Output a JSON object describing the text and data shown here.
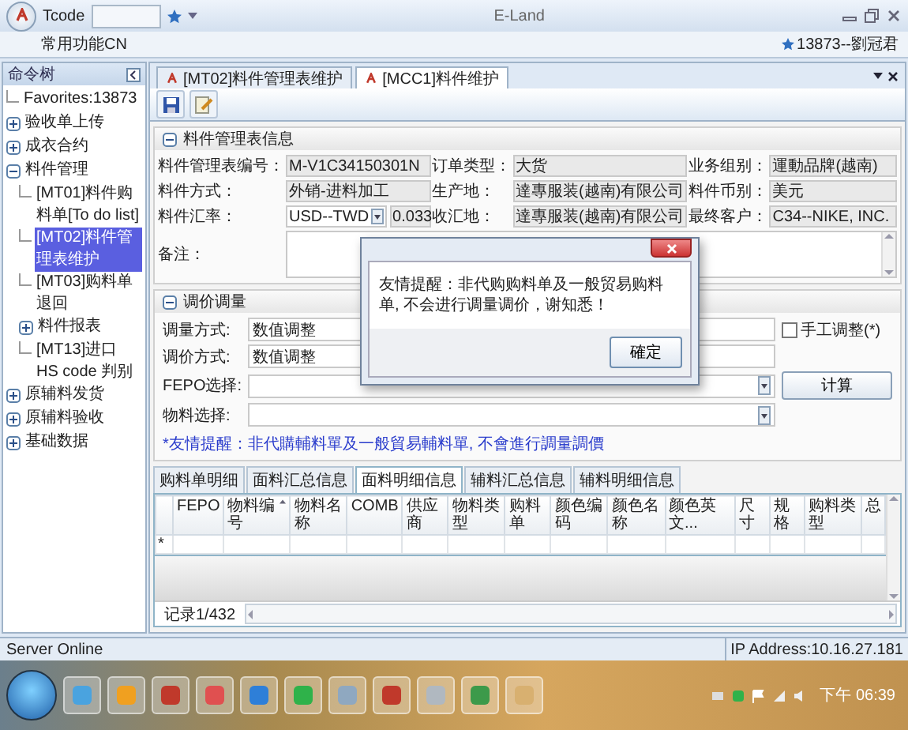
{
  "titlebar": {
    "tcode_label": "Tcode",
    "title": "E-Land"
  },
  "ribbon": {
    "menu": "常用功能CN",
    "user": "13873--劉冠君"
  },
  "sidebar": {
    "title": "命令树",
    "items": [
      {
        "label": "Favorites:13873",
        "selected": false
      },
      {
        "label": "验收单上传",
        "expanded": false,
        "selected": false
      },
      {
        "label": "成衣合约",
        "expanded": false,
        "selected": false
      },
      {
        "label": "料件管理",
        "expanded": true,
        "selected": false,
        "children": [
          {
            "label": "[MT01]料件购料单[To do list]",
            "selected": false
          },
          {
            "label": "[MT02]料件管理表维护",
            "selected": true
          },
          {
            "label": "[MT03]购料单退回",
            "selected": false
          },
          {
            "label": "料件报表",
            "expanded": false,
            "selected": false
          },
          {
            "label": "[MT13]进口 HS code 判别",
            "selected": false
          }
        ]
      },
      {
        "label": "原辅料发货",
        "expanded": false,
        "selected": false
      },
      {
        "label": "原辅料验收",
        "expanded": false,
        "selected": false
      },
      {
        "label": "基础数据",
        "expanded": false,
        "selected": false
      }
    ]
  },
  "tabs": [
    {
      "label": "[MT02]料件管理表维护",
      "selected": false
    },
    {
      "label": "[MCC1]料件维护",
      "selected": true
    }
  ],
  "info_section": {
    "title": "料件管理表信息",
    "fields": [
      {
        "label": "料件管理表编号：",
        "value": "M-V1C34150301N",
        "kind": "text"
      },
      {
        "label": "订单类型：",
        "value": "大货",
        "kind": "text"
      },
      {
        "label": "业务组别：",
        "value": "運動品牌(越南)",
        "kind": "text"
      },
      {
        "label": "料件方式：",
        "value": "外销-进料加工",
        "kind": "text"
      },
      {
        "label": "生产地：",
        "value": "達專服装(越南)有限公司",
        "kind": "text"
      },
      {
        "label": "料件币别：",
        "value": "美元",
        "kind": "text"
      },
      {
        "label": "料件汇率：",
        "value": "USD--TWD",
        "extra": "0.033",
        "kind": "select"
      },
      {
        "label": "收汇地：",
        "value": "達專服装(越南)有限公司",
        "kind": "text"
      },
      {
        "label": "最终客户：",
        "value": "C34--NIKE, INC.",
        "kind": "text"
      }
    ],
    "remark_label": "备注："
  },
  "adjust_section": {
    "title": "调价调量",
    "rows": [
      {
        "label": "调量方式:",
        "kind": "text",
        "value": "数值调整",
        "side": {
          "kind": "checkbox",
          "label": "手工调整(*)",
          "checked": false
        }
      },
      {
        "label": "调价方式:",
        "kind": "text",
        "value": "数值调整"
      },
      {
        "label": "FEPO选择:",
        "kind": "select",
        "side": {
          "kind": "button",
          "label": "计算"
        }
      },
      {
        "label": "物料选择:",
        "kind": "select"
      }
    ],
    "hint": "*友情提醒：非代購輔料單及一般貿易輔料單, 不會進行調量調價"
  },
  "detail_tabs": [
    {
      "label": "购料单明细",
      "selected": false
    },
    {
      "label": "面料汇总信息",
      "selected": false
    },
    {
      "label": "面料明细信息",
      "selected": true
    },
    {
      "label": "辅料汇总信息",
      "selected": false
    },
    {
      "label": "辅料明细信息",
      "selected": false
    }
  ],
  "grid": {
    "columns": [
      {
        "label": "FEPO",
        "sorted": false
      },
      {
        "label": "物料编号",
        "sorted": true
      },
      {
        "label": "物料名称",
        "sorted": false
      },
      {
        "label": "COMB",
        "sorted": false
      },
      {
        "label": "供应商",
        "sorted": false
      },
      {
        "label": "物料类型",
        "sorted": false
      },
      {
        "label": "购料单",
        "sorted": false
      },
      {
        "label": "颜色编码",
        "sorted": false
      },
      {
        "label": "颜色名称",
        "sorted": false
      },
      {
        "label": "颜色英文...",
        "sorted": false
      },
      {
        "label": "尺寸",
        "sorted": false
      },
      {
        "label": "规格",
        "sorted": false
      },
      {
        "label": "购料类型",
        "sorted": false
      },
      {
        "label": "总",
        "sorted": false
      }
    ],
    "new_row_marker": "*",
    "footer": "记录1/432"
  },
  "dialog": {
    "message": "友情提醒：非代购购料单及一般贸易购料单, 不会进行调量调价，谢知悉！",
    "button": "確定"
  },
  "status_bar": {
    "left": "Server Online",
    "right": "IP Address:10.16.27.181"
  },
  "taskbar": {
    "clock": "下午 06:39"
  }
}
